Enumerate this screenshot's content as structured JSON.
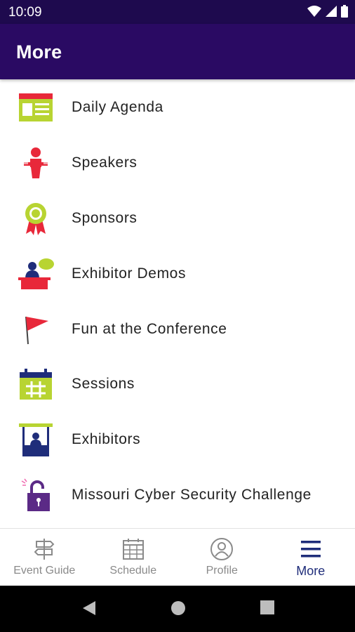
{
  "status": {
    "time": "10:09"
  },
  "header": {
    "title": "More"
  },
  "menu": [
    {
      "label": "Daily Agenda",
      "icon": "agenda-icon"
    },
    {
      "label": "Speakers",
      "icon": "speaker-icon"
    },
    {
      "label": "Sponsors",
      "icon": "ribbon-icon"
    },
    {
      "label": "Exhibitor Demos",
      "icon": "demo-icon"
    },
    {
      "label": "Fun at the Conference",
      "icon": "flag-icon"
    },
    {
      "label": "Sessions",
      "icon": "calendar-icon"
    },
    {
      "label": "Exhibitors",
      "icon": "booth-icon"
    },
    {
      "label": "Missouri Cyber Security Challenge",
      "icon": "unlocked-padlock-icon"
    }
  ],
  "bottom_nav": [
    {
      "label": "Event Guide",
      "icon": "signpost-icon",
      "active": false
    },
    {
      "label": "Schedule",
      "icon": "schedule-icon",
      "active": false
    },
    {
      "label": "Profile",
      "icon": "profile-icon",
      "active": false
    },
    {
      "label": "More",
      "icon": "hamburger-icon",
      "active": true
    }
  ],
  "colors": {
    "status_bar": "#1e0a4e",
    "app_bar": "#2a0a63",
    "lime": "#b8d432",
    "red": "#e8283a",
    "navy": "#1f2d7a",
    "purple": "#5b2a86",
    "active_nav": "#1f2d7a"
  }
}
